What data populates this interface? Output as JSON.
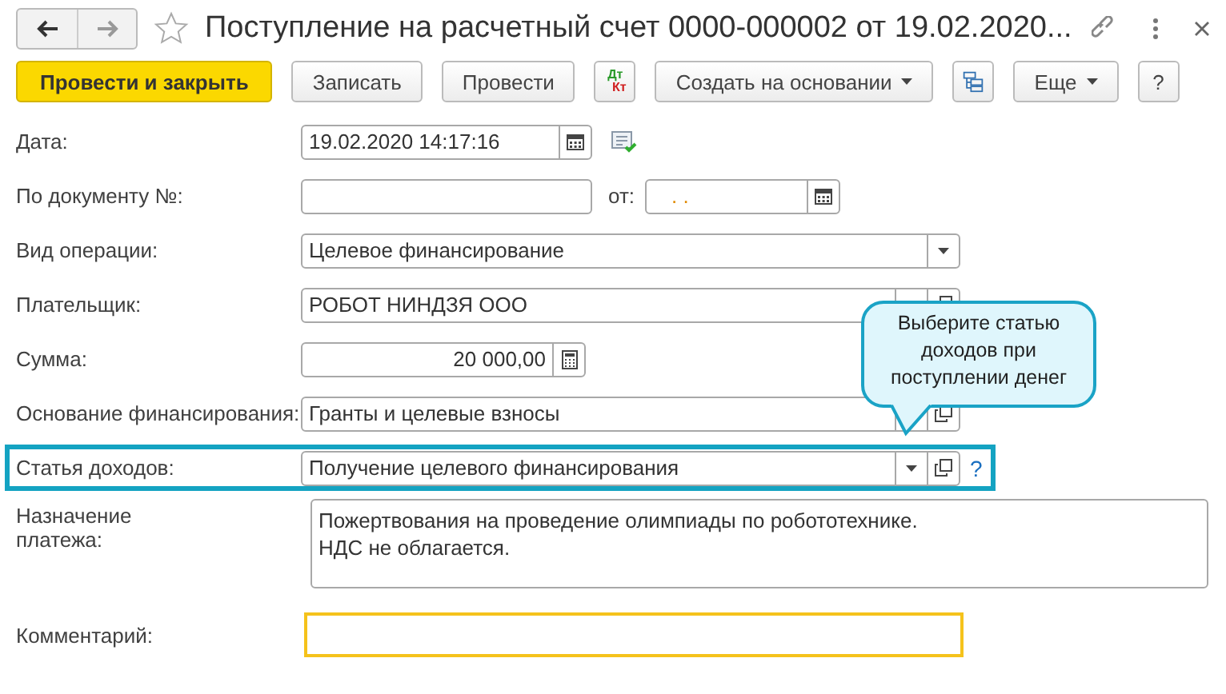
{
  "window": {
    "title": "Поступление на расчетный счет 0000-000002 от 19.02.2020...",
    "favorite": false
  },
  "toolbar": [
    {
      "kind": "primary",
      "label": "Провести и закрыть"
    },
    {
      "kind": "button",
      "label": "Записать"
    },
    {
      "kind": "button",
      "label": "Провести"
    },
    {
      "kind": "dtkt",
      "label": "Дт",
      "label2": "Кт"
    },
    {
      "kind": "menu",
      "label": "Создать на основании"
    },
    {
      "kind": "structure"
    },
    {
      "kind": "menu",
      "label": "Еще"
    },
    {
      "kind": "button",
      "label": "?"
    }
  ],
  "fields": [
    {
      "kind": "datetime",
      "label": "Дата:",
      "value": "19.02.2020 14:17:16",
      "posted": true
    },
    {
      "kind": "number",
      "label": "По документу №:",
      "date_label": "от:",
      "date_mask": ".  ."
    },
    {
      "kind": "select",
      "label": "Вид операции:",
      "value": "Целевое финансирование",
      "open_button": false,
      "highlighted": false
    },
    {
      "kind": "select",
      "label": "Плательщик:",
      "value": "РОБОТ НИНДЗЯ ООО",
      "open_button": true,
      "highlighted": false
    },
    {
      "kind": "amount",
      "label": "Сумма:",
      "value": "20 000,00"
    },
    {
      "kind": "select",
      "label": "Основание финансирования:",
      "value": "Гранты и целевые взносы",
      "open_button": true,
      "highlighted": false
    },
    {
      "kind": "select",
      "label": "Статья доходов:",
      "value": "Получение целевого финансирования",
      "open_button": true,
      "highlighted": true,
      "help": "?"
    }
  ],
  "purpose": {
    "label": "Назначение платежа:",
    "value": "Пожертвования на проведение олимпиады по робототехнике.\nНДС не облагается."
  },
  "comment": {
    "label": "Комментарий:",
    "focused": true
  },
  "callout": {
    "text": "Выберите статью доходов при поступлении денег"
  }
}
